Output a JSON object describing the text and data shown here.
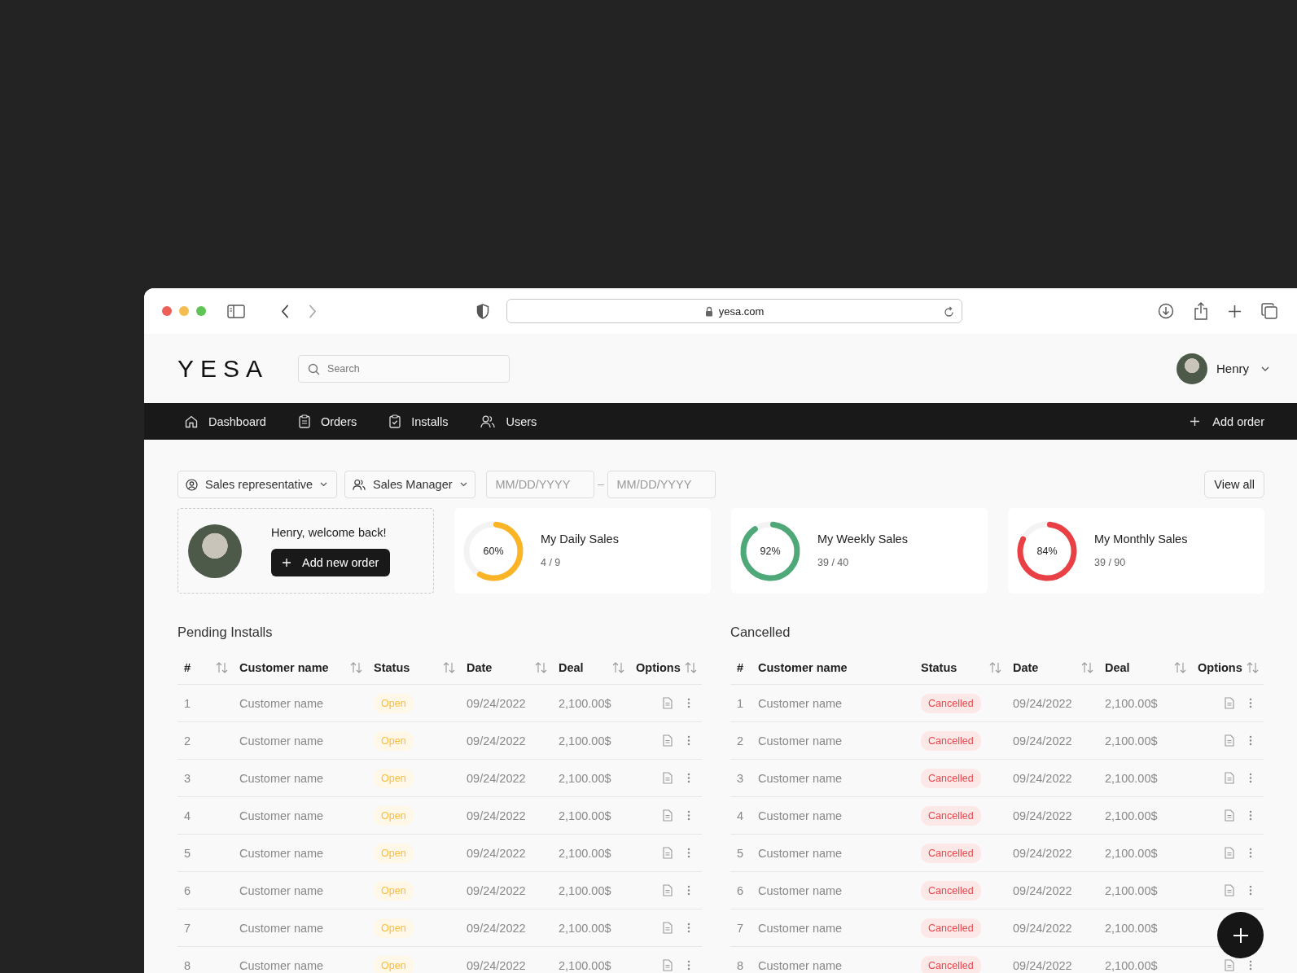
{
  "browser": {
    "url": "yesa.com"
  },
  "header": {
    "logo": "YESA",
    "search": {
      "placeholder": "Search"
    },
    "user": {
      "name": "Henry"
    }
  },
  "nav": {
    "items": [
      {
        "label": "Dashboard",
        "kind": "home"
      },
      {
        "label": "Orders",
        "kind": "orders"
      },
      {
        "label": "Installs",
        "kind": "installs"
      },
      {
        "label": "Users",
        "kind": "users"
      }
    ],
    "action": {
      "label": "Add order"
    }
  },
  "filters": {
    "role_select": "Sales representative",
    "manager_select": "Sales Manager",
    "date_from": {
      "placeholder": "MM/DD/YYYY"
    },
    "date_to": {
      "placeholder": "MM/DD/YYYY"
    },
    "view_all": "View all"
  },
  "welcome": {
    "greeting": "Henry, welcome back!",
    "button": "Add new order"
  },
  "stats": [
    {
      "title": "My Daily Sales",
      "reading": "60%",
      "count": "4 / 9",
      "level": 0.6,
      "color": "#fbb425"
    },
    {
      "title": "My Weekly Sales",
      "reading": "92%",
      "count": "39 / 40",
      "level": 0.92,
      "color": "#4fa878"
    },
    {
      "title": "My Monthly Sales",
      "reading": "84%",
      "count": "39 / 90",
      "level": 0.84,
      "color": "#e84045"
    }
  ],
  "tables": [
    {
      "title": "Pending Installs",
      "columns": [
        {
          "label": "#",
          "sortable": true
        },
        {
          "label": "Customer name",
          "sortable": true
        },
        {
          "label": "Status",
          "sortable": true
        },
        {
          "label": "Date",
          "sortable": true
        },
        {
          "label": "Deal",
          "sortable": true
        },
        {
          "label": "Options",
          "sortable": true
        }
      ],
      "rows": [
        {
          "number": "1",
          "customer": "Customer name",
          "status": {
            "label": "Open",
            "kind": "open"
          },
          "date": "09/24/2022",
          "deal": "2,100.00$"
        },
        {
          "number": "2",
          "customer": "Customer name",
          "status": {
            "label": "Open",
            "kind": "open"
          },
          "date": "09/24/2022",
          "deal": "2,100.00$"
        },
        {
          "number": "3",
          "customer": "Customer name",
          "status": {
            "label": "Open",
            "kind": "open"
          },
          "date": "09/24/2022",
          "deal": "2,100.00$"
        },
        {
          "number": "4",
          "customer": "Customer name",
          "status": {
            "label": "Open",
            "kind": "open"
          },
          "date": "09/24/2022",
          "deal": "2,100.00$"
        },
        {
          "number": "5",
          "customer": "Customer name",
          "status": {
            "label": "Open",
            "kind": "open"
          },
          "date": "09/24/2022",
          "deal": "2,100.00$"
        },
        {
          "number": "6",
          "customer": "Customer name",
          "status": {
            "label": "Open",
            "kind": "open"
          },
          "date": "09/24/2022",
          "deal": "2,100.00$"
        },
        {
          "number": "7",
          "customer": "Customer name",
          "status": {
            "label": "Open",
            "kind": "open"
          },
          "date": "09/24/2022",
          "deal": "2,100.00$"
        },
        {
          "number": "8",
          "customer": "Customer name",
          "status": {
            "label": "Open",
            "kind": "open"
          },
          "date": "09/24/2022",
          "deal": "2,100.00$"
        }
      ]
    },
    {
      "title": "Cancelled",
      "columns": [
        {
          "label": "#",
          "sortable": false
        },
        {
          "label": "Customer name",
          "sortable": false
        },
        {
          "label": "Status",
          "sortable": true
        },
        {
          "label": "Date",
          "sortable": true
        },
        {
          "label": "Deal",
          "sortable": true
        },
        {
          "label": "Options",
          "sortable": true
        }
      ],
      "rows": [
        {
          "number": "1",
          "customer": "Customer name",
          "status": {
            "label": "Cancelled",
            "kind": "cancelled"
          },
          "date": "09/24/2022",
          "deal": "2,100.00$"
        },
        {
          "number": "2",
          "customer": "Customer name",
          "status": {
            "label": "Cancelled",
            "kind": "cancelled"
          },
          "date": "09/24/2022",
          "deal": "2,100.00$"
        },
        {
          "number": "3",
          "customer": "Customer name",
          "status": {
            "label": "Cancelled",
            "kind": "cancelled"
          },
          "date": "09/24/2022",
          "deal": "2,100.00$"
        },
        {
          "number": "4",
          "customer": "Customer name",
          "status": {
            "label": "Cancelled",
            "kind": "cancelled"
          },
          "date": "09/24/2022",
          "deal": "2,100.00$"
        },
        {
          "number": "5",
          "customer": "Customer name",
          "status": {
            "label": "Cancelled",
            "kind": "cancelled"
          },
          "date": "09/24/2022",
          "deal": "2,100.00$"
        },
        {
          "number": "6",
          "customer": "Customer name",
          "status": {
            "label": "Cancelled",
            "kind": "cancelled"
          },
          "date": "09/24/2022",
          "deal": "2,100.00$"
        },
        {
          "number": "7",
          "customer": "Customer name",
          "status": {
            "label": "Cancelled",
            "kind": "cancelled"
          },
          "date": "09/24/2022",
          "deal": "2,100.00$"
        },
        {
          "number": "8",
          "customer": "Customer name",
          "status": {
            "label": "Cancelled",
            "kind": "cancelled"
          },
          "date": "09/24/2022",
          "deal": "2,100.00$"
        }
      ]
    }
  ]
}
